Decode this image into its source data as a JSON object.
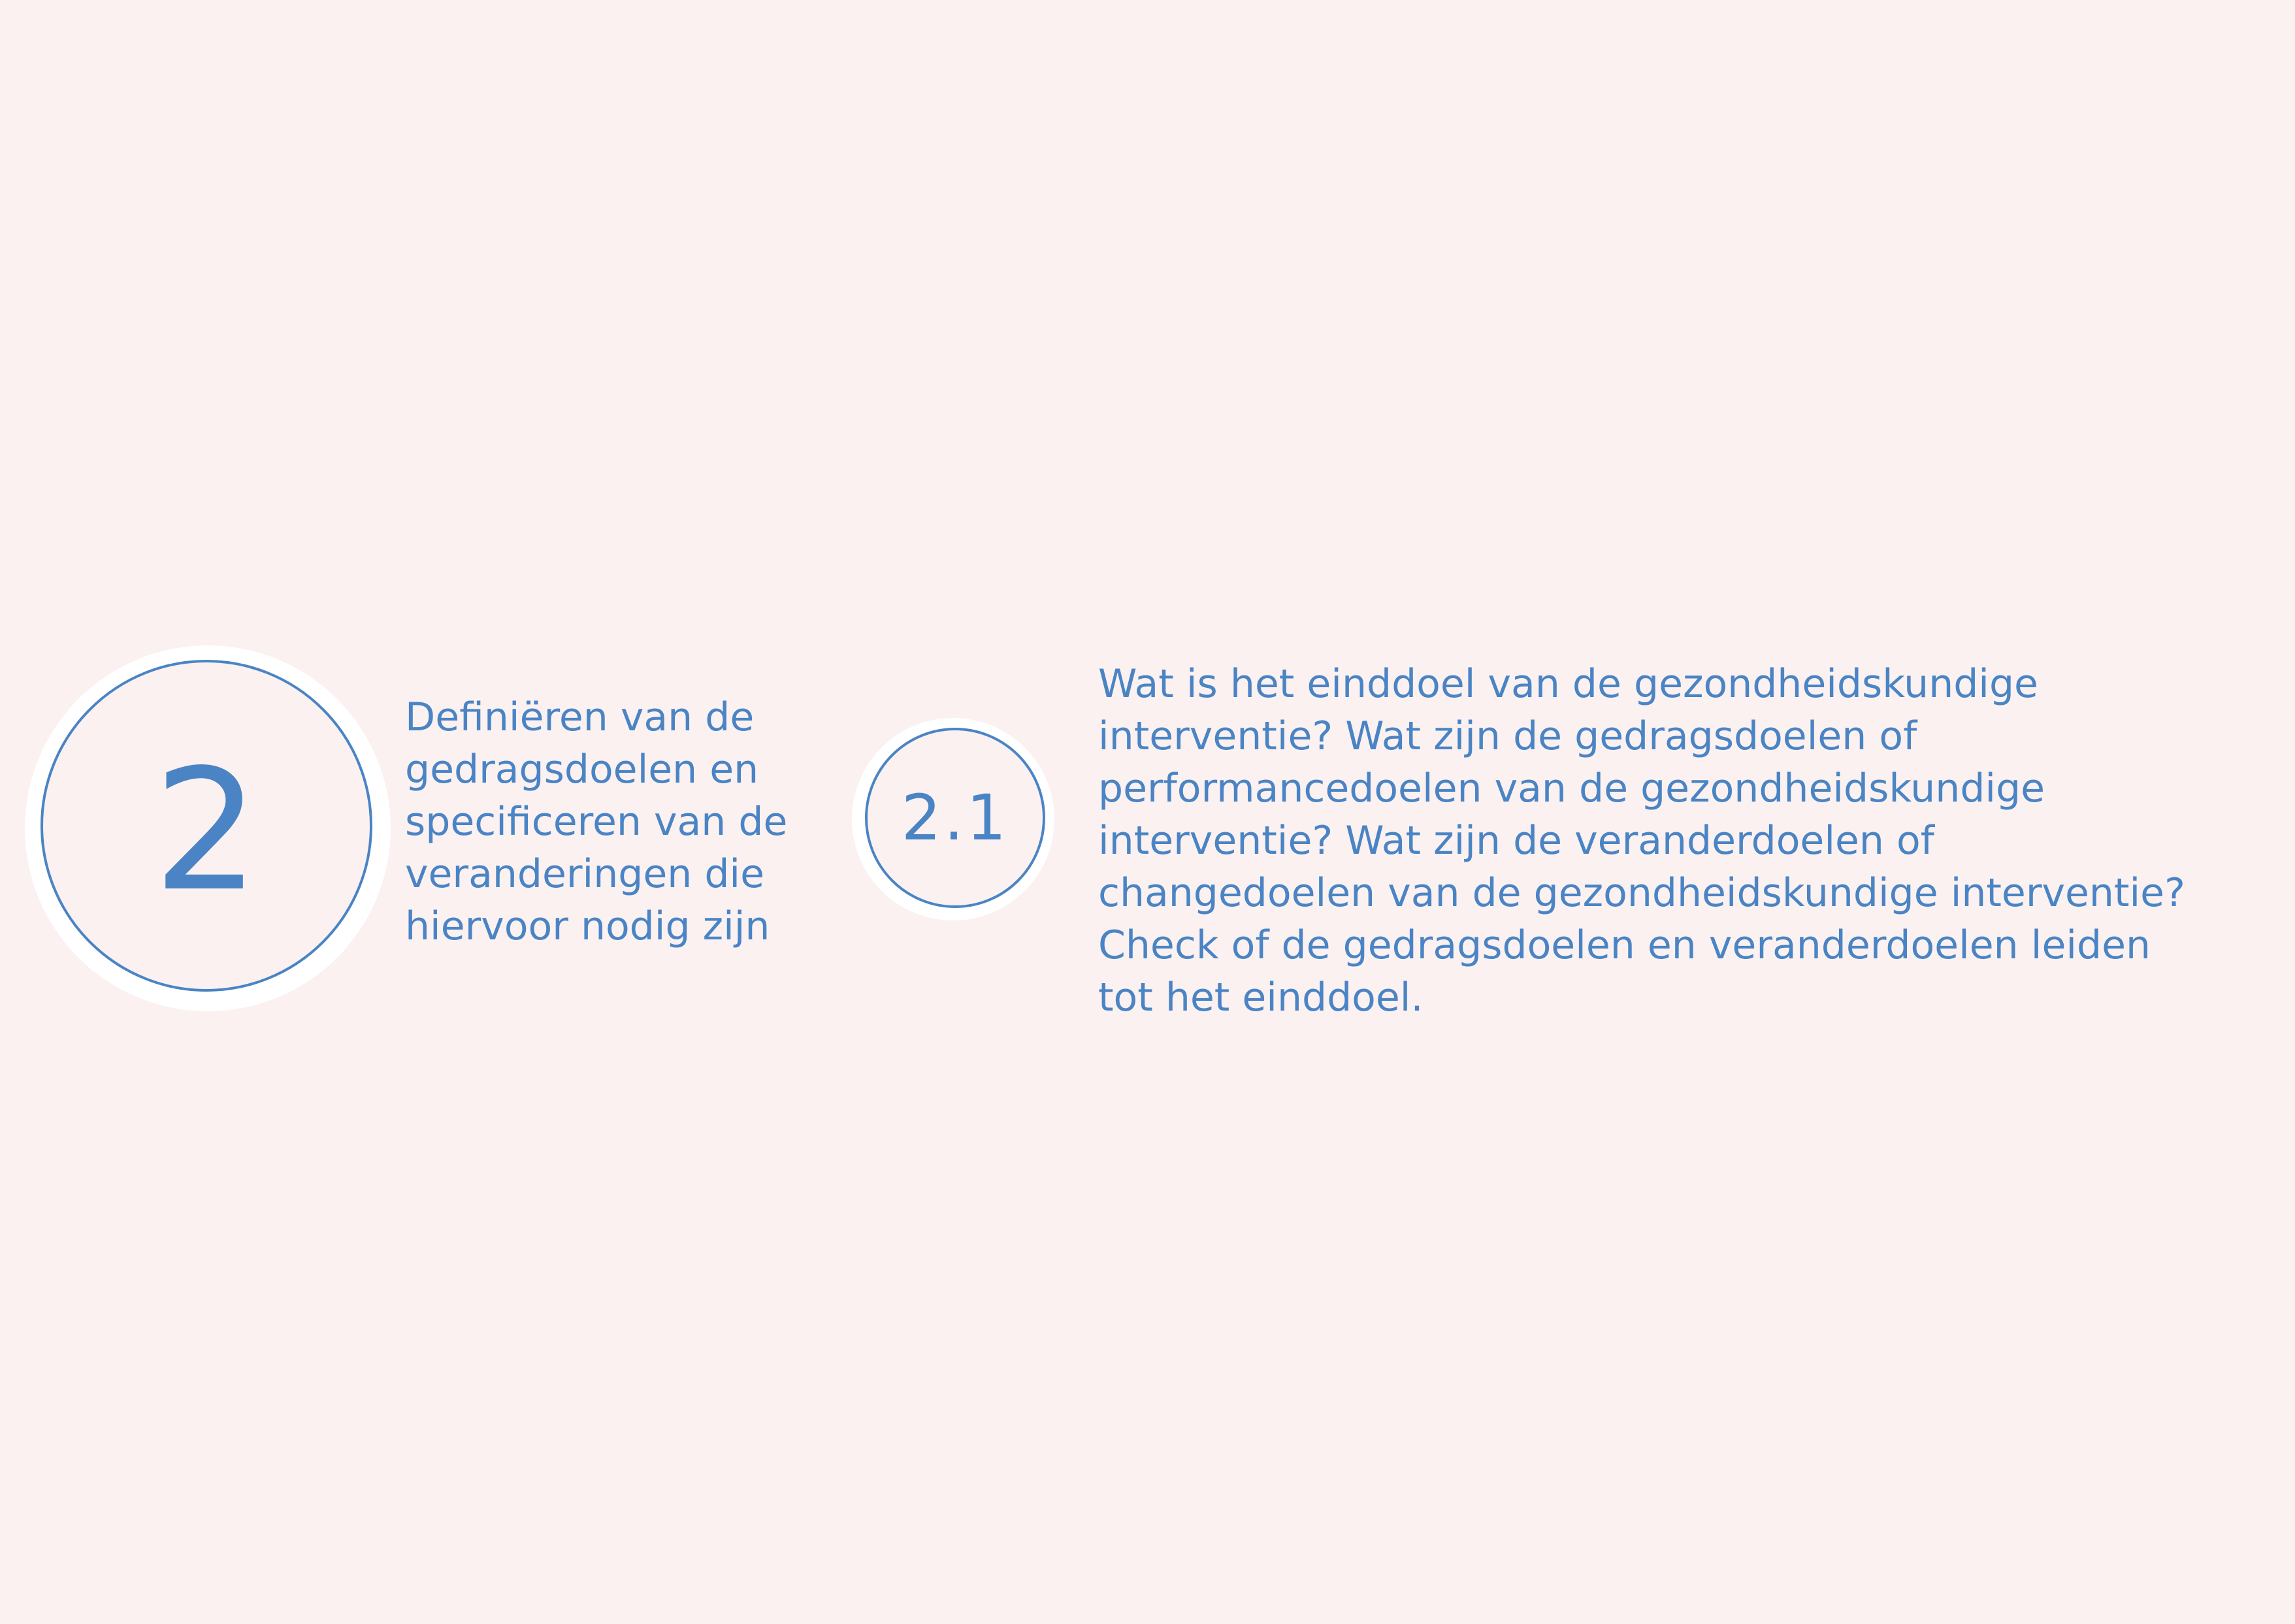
{
  "step": {
    "number": "2",
    "description_lines": [
      "Definiëren van de",
      "gedragsdoelen en",
      "specificeren van de",
      "veranderingen die",
      "hiervoor nodig zijn"
    ]
  },
  "substep": {
    "number": "2.1",
    "question_lines": [
      "Wat is het einddoel van de gezondheidskundige",
      "interventie? Wat zijn de gedragsdoelen of",
      "performancedoelen van de gezondheidskundige",
      "interventie? Wat zijn de veranderdoelen of",
      "changedoelen van de gezondheidskundige interventie?",
      "Check of de gedragsdoelen en veranderdoelen leiden",
      "tot het einddoel."
    ]
  },
  "colors": {
    "background": "#fbf1f1",
    "accent": "#4a84c4",
    "halo": "#ffffff"
  }
}
